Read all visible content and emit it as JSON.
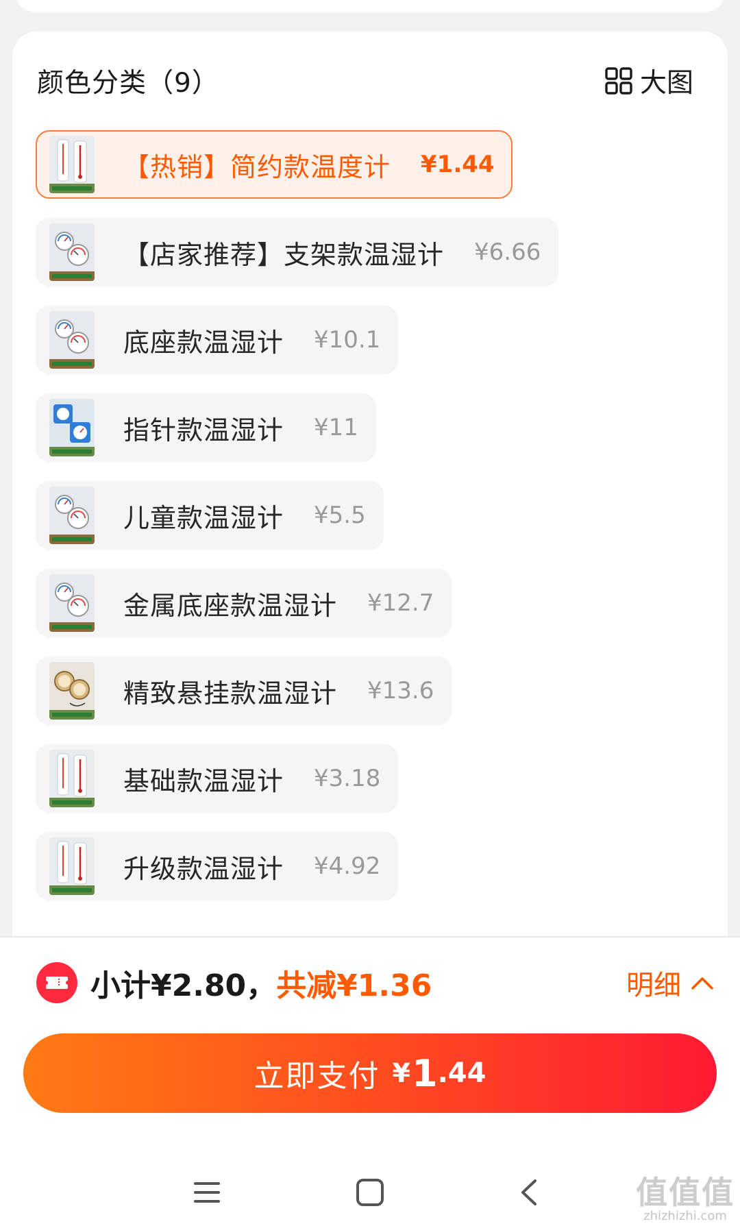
{
  "section": {
    "title": "颜色分类（9）",
    "big_image_label": "大图"
  },
  "skus": [
    {
      "name": "【热销】简约款温度计",
      "price": "¥1.44",
      "selected": true,
      "thumb": "white-thermometer"
    },
    {
      "name": "【店家推荐】支架款温湿计",
      "price": "¥6.66",
      "selected": false,
      "thumb": "dial-thermometer"
    },
    {
      "name": "底座款温湿计",
      "price": "¥10.1",
      "selected": false,
      "thumb": "dial-thermometer"
    },
    {
      "name": "指针款温湿计",
      "price": "¥11",
      "selected": false,
      "thumb": "blue-dial-thermometer"
    },
    {
      "name": "儿童款温湿计",
      "price": "¥5.5",
      "selected": false,
      "thumb": "dial-thermometer"
    },
    {
      "name": "金属底座款温湿计",
      "price": "¥12.7",
      "selected": false,
      "thumb": "dial-thermometer"
    },
    {
      "name": "精致悬挂款温湿计",
      "price": "¥13.6",
      "selected": false,
      "thumb": "wood-dial-thermometer"
    },
    {
      "name": "基础款温湿计",
      "price": "¥3.18",
      "selected": false,
      "thumb": "white-thermometer"
    },
    {
      "name": "升级款温湿计",
      "price": "¥4.92",
      "selected": false,
      "thumb": "white-thermometer"
    }
  ],
  "summary": {
    "subtotal": "小计¥2.80，",
    "discount": "共减¥1.36",
    "details_label": "明细"
  },
  "pay": {
    "label": "立即支付",
    "currency": "¥",
    "amount_int": "1",
    "amount_dec": ".44"
  },
  "watermark": {
    "big": "值值值",
    "small": "zhizhizhi.com"
  },
  "colors": {
    "accent": "#ff5a00",
    "pay_gradient_start": "#ff7a14",
    "pay_gradient_end": "#ff1a34",
    "selected_bg": "#fff1ea",
    "selected_border": "#ff7a3a"
  }
}
